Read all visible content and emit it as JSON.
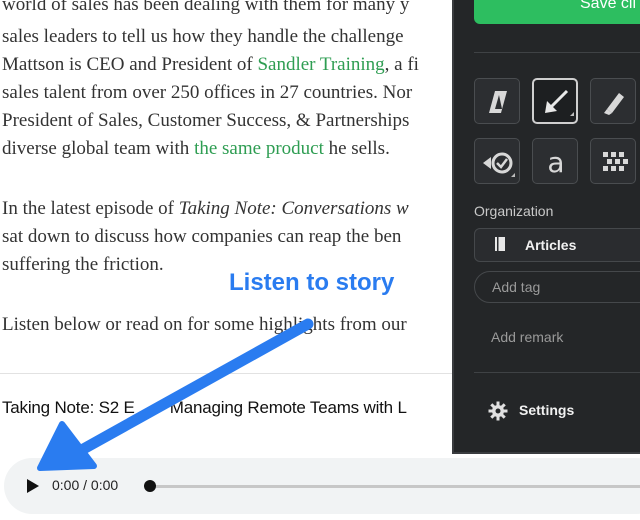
{
  "article": {
    "lines": [
      "world of sales has been dealing with them for many y",
      "sales leaders to tell us how they handle the challenge",
      {
        "pre": "Mattson is CEO and President of ",
        "link": "Sandler Training",
        "post": ", a fi"
      },
      "sales talent from over 250 offices in 27 countries. Nor",
      "President of Sales, Customer Success, & Partnerships",
      {
        "pre": "diverse global team with ",
        "link": "the same product",
        "post": " he sells."
      }
    ],
    "lines2": [
      {
        "pre": "In the latest episode of ",
        "em": "Taking Note: Conversations w",
        "post": ""
      },
      "sat down to discuss how companies can reap the ben",
      "suffering the friction."
    ],
    "line3": "Listen below or read on for some highlights from our",
    "track_title": "Taking Note: S2 E_ — Managing Remote Teams with L"
  },
  "callout": {
    "text": "Listen to story",
    "color": "#2a7cf0"
  },
  "player": {
    "time": "0:00 / 0:00",
    "progress": 0
  },
  "panel": {
    "save_label": "Save cli",
    "organization_label": "Organization",
    "notebook": "Articles",
    "tag_placeholder": "Add tag",
    "remark_placeholder": "Add remark",
    "settings_label": "Settings",
    "accent": "#2dbe60",
    "tools": [
      "text-style-icon",
      "arrow-icon",
      "highlighter-icon",
      "stamp-icon",
      "typeface-icon",
      "pixelate-icon"
    ]
  }
}
